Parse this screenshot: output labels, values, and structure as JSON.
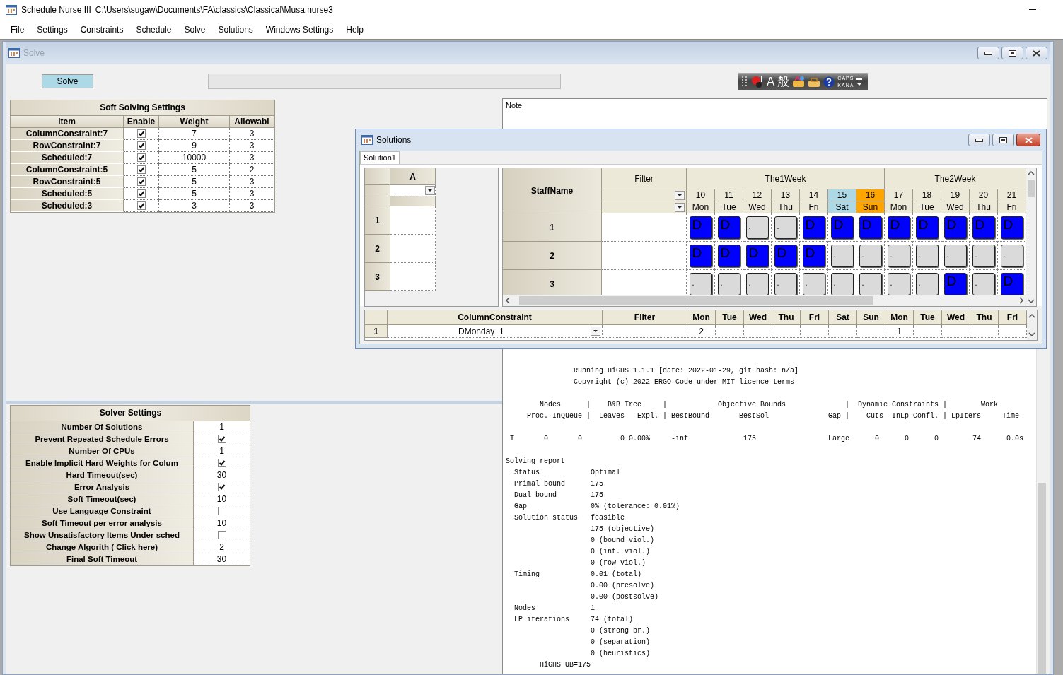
{
  "window": {
    "title": "Schedule Nurse III",
    "path": "C:\\Users\\sugaw\\Documents\\FA\\classics\\Classical\\Musa.nurse3"
  },
  "menu": [
    "File",
    "Settings",
    "Constraints",
    "Schedule",
    "Solve",
    "Solutions",
    "Windows Settings",
    "Help"
  ],
  "solve_window": {
    "title": "Solve",
    "solve_button": "Solve",
    "ime_bar": {
      "mode": "A",
      "input": "般",
      "caps": "CAPS",
      "kana": "KANA"
    },
    "soft_settings": {
      "title": "Soft Solving Settings",
      "columns": [
        "Item",
        "Enable",
        "Weight",
        "Allowabl"
      ],
      "rows": [
        {
          "item": "ColumnConstraint:7",
          "enabled": true,
          "weight": "7",
          "allowable": "3"
        },
        {
          "item": "RowConstraint:7",
          "enabled": true,
          "weight": "9",
          "allowable": "3"
        },
        {
          "item": "Scheduled:7",
          "enabled": true,
          "weight": "10000",
          "allowable": "3"
        },
        {
          "item": "ColumnConstraint:5",
          "enabled": true,
          "weight": "5",
          "allowable": "2"
        },
        {
          "item": "RowConstraint:5",
          "enabled": true,
          "weight": "5",
          "allowable": "3"
        },
        {
          "item": "Scheduled:5",
          "enabled": true,
          "weight": "5",
          "allowable": "3"
        },
        {
          "item": "Scheduled:3",
          "enabled": true,
          "weight": "3",
          "allowable": "3"
        }
      ]
    },
    "solver_settings": {
      "title": "Solver Settings",
      "rows": [
        {
          "label": "Number Of Solutions",
          "kind": "number",
          "value": "1"
        },
        {
          "label": "Prevent Repeated Schedule Errors",
          "kind": "check",
          "checked": true
        },
        {
          "label": "Number Of CPUs",
          "kind": "number",
          "value": "1"
        },
        {
          "label": "Enable Implicit Hard Weights for Colum",
          "kind": "check",
          "checked": true
        },
        {
          "label": "Hard Timeout(sec)",
          "kind": "number",
          "value": "30"
        },
        {
          "label": "Error Analysis",
          "kind": "check",
          "checked": true
        },
        {
          "label": "Soft Timeout(sec)",
          "kind": "number",
          "value": "10"
        },
        {
          "label": "Use Language Constraint",
          "kind": "check",
          "checked": false
        },
        {
          "label": "Soft Timeout per error analysis",
          "kind": "number",
          "value": "10"
        },
        {
          "label": "Show Unsatisfactory Items Under sched",
          "kind": "check",
          "checked": false
        },
        {
          "label": "Change Algorith ( Click here)",
          "kind": "number",
          "value": "2"
        },
        {
          "label": "Final Soft Timeout",
          "kind": "number",
          "value": "30"
        }
      ]
    },
    "note": {
      "label": "Note"
    },
    "log": [
      {
        "lines": [
          "                Running HiGHS 1.1.1 [date: 2022-01-29, git hash: n/a]",
          "                Copyright (c) 2022 ERGO-Code under MIT licence terms"
        ]
      },
      {
        "lines": [
          "        Nodes      |    B&B Tree     |            Objective Bounds              |  Dynamic Constraints |        Work",
          "     Proc. InQueue |  Leaves   Expl. | BestBound       BestSol              Gap |    Cuts  InLp Confl. | LpIters     Time"
        ]
      },
      {
        "lines": [
          " T       0       0         0 0.00%     -inf             175                 Large      0      0      0        74      0.0s"
        ]
      },
      {
        "lines": [
          "Solving report",
          "  Status            Optimal",
          "  Primal bound      175",
          "  Dual bound        175",
          "  Gap               0% (tolerance: 0.01%)",
          "  Solution status   feasible",
          "                    175 (objective)",
          "                    0 (bound viol.)",
          "                    0 (int. viol.)",
          "                    0 (row viol.)",
          "  Timing            0.01 (total)",
          "                    0.00 (presolve)",
          "                    0.00 (postsolve)",
          "  Nodes             1",
          "  LP iterations     74 (total)",
          "                    0 (strong br.)",
          "                    0 (separation)",
          "                    0 (heuristics)",
          "        HiGHS UB=175"
        ]
      }
    ]
  },
  "solutions_window": {
    "title": "Solutions",
    "tabs": [
      {
        "label": "Solution1",
        "selected": true
      }
    ],
    "side_grid": {
      "column": "A",
      "rows": [
        "1",
        "2",
        "3"
      ]
    },
    "schedule": {
      "corner": "StaffName",
      "filter": "Filter",
      "weeks": [
        {
          "label": "The1Week",
          "days": [
            {
              "date": "10",
              "day": "Mon",
              "kind": "weekday"
            },
            {
              "date": "11",
              "day": "Tue",
              "kind": "weekday"
            },
            {
              "date": "12",
              "day": "Wed",
              "kind": "weekday"
            },
            {
              "date": "13",
              "day": "Thu",
              "kind": "weekday"
            },
            {
              "date": "14",
              "day": "Fri",
              "kind": "weekday"
            },
            {
              "date": "15",
              "day": "Sat",
              "kind": "saturday"
            },
            {
              "date": "16",
              "day": "Sun",
              "kind": "sunday"
            }
          ]
        },
        {
          "label": "The2Week",
          "days": [
            {
              "date": "17",
              "day": "Mon",
              "kind": "weekday"
            },
            {
              "date": "18",
              "day": "Tue",
              "kind": "weekday"
            },
            {
              "date": "19",
              "day": "Wed",
              "kind": "weekday"
            },
            {
              "date": "20",
              "day": "Thu",
              "kind": "weekday"
            },
            {
              "date": "21",
              "day": "Fri",
              "kind": "weekday"
            }
          ]
        }
      ],
      "rows": [
        {
          "name": "1",
          "cells": [
            {
              "text": "D",
              "assigned": true
            },
            {
              "text": "D",
              "assigned": true
            },
            {
              "text": ".",
              "assigned": false
            },
            {
              "text": ".",
              "assigned": false
            },
            {
              "text": "D",
              "assigned": true
            },
            {
              "text": "D",
              "assigned": true
            },
            {
              "text": "D",
              "assigned": true
            },
            {
              "text": "D",
              "assigned": true
            },
            {
              "text": "D",
              "assigned": true
            },
            {
              "text": "D",
              "assigned": true
            },
            {
              "text": "D",
              "assigned": true
            },
            {
              "text": "D",
              "assigned": true
            }
          ]
        },
        {
          "name": "2",
          "cells": [
            {
              "text": "D",
              "assigned": true
            },
            {
              "text": "D",
              "assigned": true
            },
            {
              "text": "D",
              "assigned": true
            },
            {
              "text": "D",
              "assigned": true
            },
            {
              "text": "D",
              "assigned": true
            },
            {
              "text": ".",
              "assigned": false
            },
            {
              "text": ".",
              "assigned": false
            },
            {
              "text": ".",
              "assigned": false
            },
            {
              "text": ".",
              "assigned": false
            },
            {
              "text": ".",
              "assigned": false
            },
            {
              "text": ".",
              "assigned": false
            },
            {
              "text": ".",
              "assigned": false
            }
          ]
        },
        {
          "name": "3",
          "cells": [
            {
              "text": ".",
              "assigned": false
            },
            {
              "text": ".",
              "assigned": false
            },
            {
              "text": ".",
              "assigned": false
            },
            {
              "text": ".",
              "assigned": false
            },
            {
              "text": ".",
              "assigned": false
            },
            {
              "text": ".",
              "assigned": false
            },
            {
              "text": ".",
              "assigned": false
            },
            {
              "text": ".",
              "assigned": false
            },
            {
              "text": ".",
              "assigned": false
            },
            {
              "text": "D",
              "assigned": true
            },
            {
              "text": ".",
              "assigned": false
            },
            {
              "text": "D",
              "assigned": true
            }
          ]
        }
      ]
    },
    "constraints_grid": {
      "columns": [
        "ColumnConstraint",
        "Filter"
      ],
      "days": [
        "Mon",
        "Tue",
        "Wed",
        "Thu",
        "Fri",
        "Sat",
        "Sun",
        "Mon",
        "Tue",
        "Wed",
        "Thu",
        "Fri"
      ],
      "rows": [
        {
          "index": "1",
          "name": "DMonday_1",
          "values": [
            {
              "kind": "value",
              "text": "2"
            },
            {
              "kind": "empty"
            },
            {
              "kind": "empty"
            },
            {
              "kind": "empty"
            },
            {
              "kind": "empty"
            },
            {
              "kind": "empty"
            },
            {
              "kind": "empty"
            },
            {
              "kind": "value",
              "text": "1"
            },
            {
              "kind": "empty"
            },
            {
              "kind": "empty"
            },
            {
              "kind": "empty"
            },
            {
              "kind": "empty"
            }
          ]
        }
      ]
    }
  }
}
